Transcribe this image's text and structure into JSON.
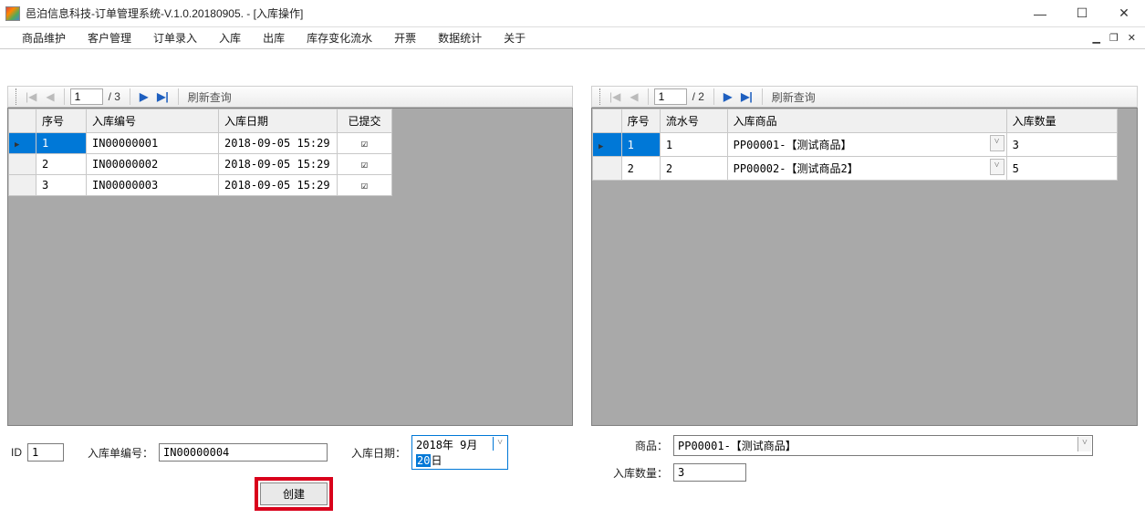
{
  "window": {
    "title": "邑泊信息科技-订单管理系统-V.1.0.20180905. - [入库操作]"
  },
  "menu": {
    "items": [
      "商品维护",
      "客户管理",
      "订单录入",
      "入库",
      "出库",
      "库存变化流水",
      "开票",
      "数据统计",
      "关于"
    ]
  },
  "leftNav": {
    "current": "1",
    "total": "/ 3",
    "refresh": "刷新查询"
  },
  "rightNav": {
    "current": "1",
    "total": "/ 2",
    "refresh": "刷新查询"
  },
  "leftGrid": {
    "headers": {
      "seq": "序号",
      "code": "入库编号",
      "date": "入库日期",
      "submitted": "已提交"
    },
    "rows": [
      {
        "seq": "1",
        "code": "IN00000001",
        "date": "2018-09-05 15:29",
        "submitted": true,
        "selected": true
      },
      {
        "seq": "2",
        "code": "IN00000002",
        "date": "2018-09-05 15:29",
        "submitted": true,
        "selected": false
      },
      {
        "seq": "3",
        "code": "IN00000003",
        "date": "2018-09-05 15:29",
        "submitted": true,
        "selected": false
      }
    ]
  },
  "rightGrid": {
    "headers": {
      "seq": "序号",
      "flow": "流水号",
      "product": "入库商品",
      "qty": "入库数量"
    },
    "rows": [
      {
        "seq": "1",
        "flow": "1",
        "product": "PP00001-【测试商品】",
        "qty": "3",
        "selected": true
      },
      {
        "seq": "2",
        "flow": "2",
        "product": "PP00002-【测试商品2】",
        "qty": "5",
        "selected": false
      }
    ]
  },
  "form": {
    "idLabel": "ID",
    "idValue": "1",
    "codeLabel": "入库单编号：",
    "codeValue": "IN00000004",
    "dateLabel": "入库日期：",
    "datePrefix": "2018年 9月",
    "dateHi": "20",
    "dateSuffix": "日",
    "createLabel": "创建",
    "productLabel": "商品：",
    "productValue": "PP00001-【测试商品】",
    "qtyLabel": "入库数量：",
    "qtyValue": "3"
  }
}
